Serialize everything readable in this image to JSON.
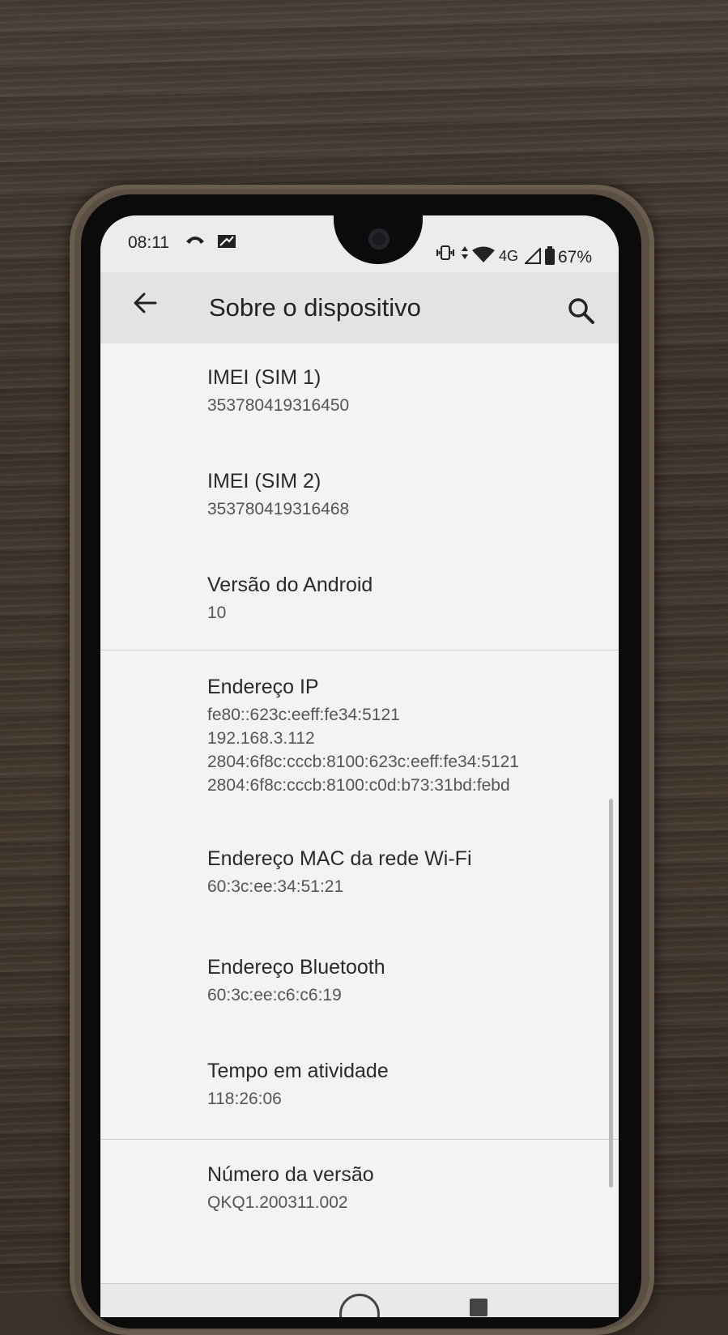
{
  "status_bar": {
    "time": "08:11",
    "network": "4G",
    "battery": "67%"
  },
  "app_bar": {
    "title": "Sobre o dispositivo"
  },
  "items": [
    {
      "title": "IMEI (SIM 1)",
      "values": [
        "353780419316450"
      ]
    },
    {
      "title": "IMEI (SIM 2)",
      "values": [
        "353780419316468"
      ]
    },
    {
      "title": "Versão do Android",
      "values": [
        "10"
      ]
    },
    {
      "title": "Endereço IP",
      "values": [
        "fe80::623c:eeff:fe34:5121",
        "192.168.3.112",
        "2804:6f8c:cccb:8100:623c:eeff:fe34:5121",
        "2804:6f8c:cccb:8100:c0d:b73:31bd:febd"
      ]
    },
    {
      "title": "Endereço MAC da rede Wi-Fi",
      "values": [
        "60:3c:ee:34:51:21"
      ]
    },
    {
      "title": "Endereço Bluetooth",
      "values": [
        "60:3c:ee:c6:c6:19"
      ]
    },
    {
      "title": "Tempo em atividade",
      "values": [
        "118:26:06"
      ]
    },
    {
      "title": "Número da versão",
      "values": [
        "QKQ1.200311.002"
      ]
    }
  ]
}
